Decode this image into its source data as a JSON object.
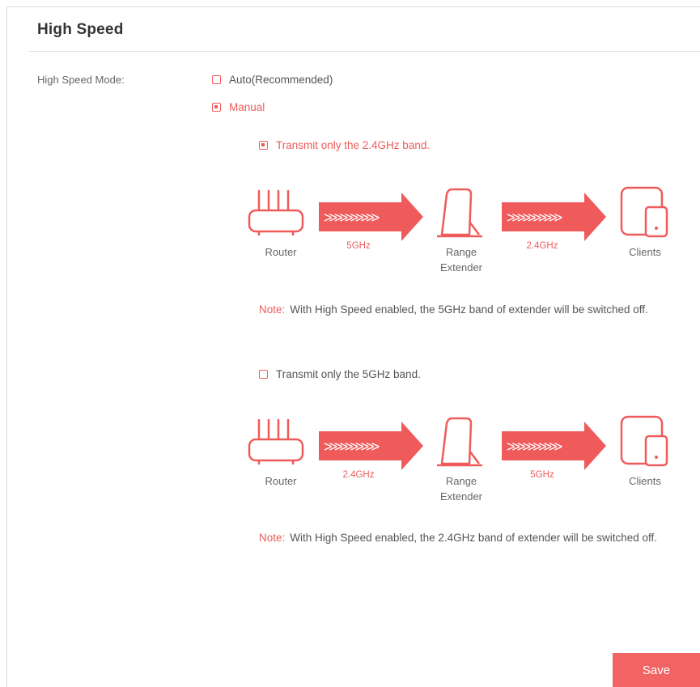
{
  "section": {
    "title": "High Speed"
  },
  "form": {
    "mode_label": "High Speed Mode:",
    "mode_options": [
      {
        "label": "Auto(Recommended)",
        "checked": false
      },
      {
        "label": "Manual",
        "checked": true
      }
    ],
    "band_options": [
      {
        "label": "Transmit only the 2.4GHz band.",
        "checked": true,
        "diagram": {
          "router_label": "Router",
          "link1_band": "5GHz",
          "extender_label_line1": "Range",
          "extender_label_line2": "Extender",
          "link2_band": "2.4GHz",
          "clients_label": "Clients"
        },
        "note_tag": "Note:",
        "note_text": "With High Speed enabled, the 5GHz band of extender will be switched off."
      },
      {
        "label": "Transmit only the 5GHz band.",
        "checked": false,
        "diagram": {
          "router_label": "Router",
          "link1_band": "2.4GHz",
          "extender_label_line1": "Range",
          "extender_label_line2": "Extender",
          "link2_band": "5GHz",
          "clients_label": "Clients"
        },
        "note_tag": "Note:",
        "note_text": "With High Speed enabled, the 2.4GHz band of extender will be switched off."
      }
    ]
  },
  "actions": {
    "save_label": "Save"
  },
  "colors": {
    "accent": "#ef5b5b",
    "button": "#f26363",
    "text": "#555555"
  },
  "icons": [
    "router-icon",
    "arrow-icon",
    "range-extender-icon",
    "clients-icon"
  ]
}
